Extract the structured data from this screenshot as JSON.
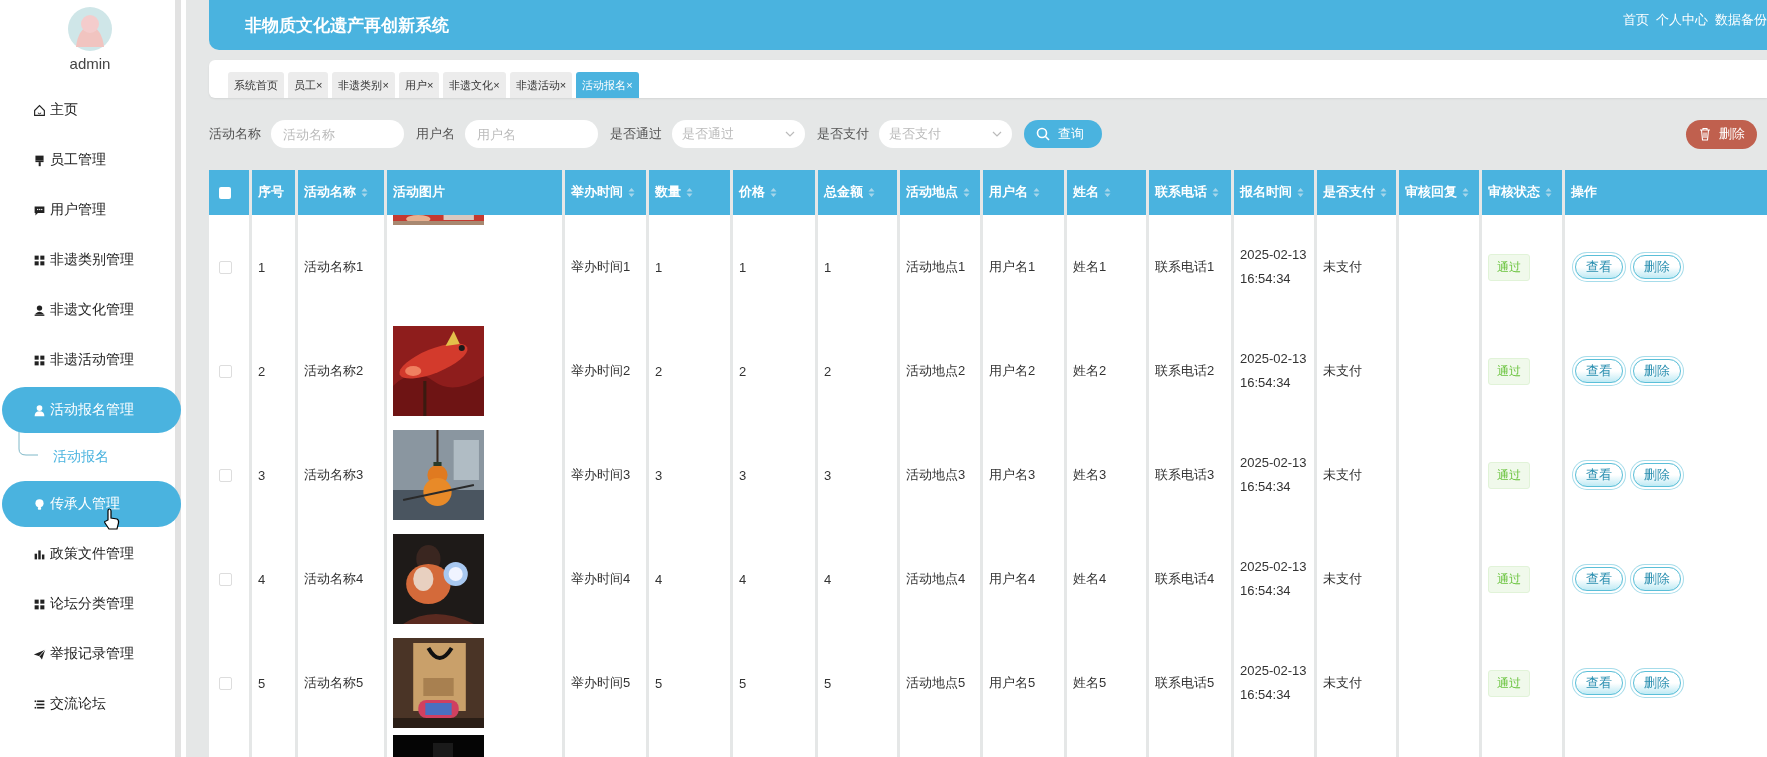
{
  "sidebar": {
    "user": {
      "name": "admin"
    },
    "items": [
      {
        "label": "主页",
        "highlighted": false
      },
      {
        "label": "员工管理",
        "highlighted": false
      },
      {
        "label": "用户管理",
        "highlighted": false
      },
      {
        "label": "非遗类别管理",
        "highlighted": false
      },
      {
        "label": "非遗文化管理",
        "highlighted": false
      },
      {
        "label": "非遗活动管理",
        "highlighted": false
      },
      {
        "label": "活动报名管理",
        "highlighted": true,
        "expanded": true,
        "children": [
          {
            "label": "活动报名",
            "selected": true
          }
        ]
      },
      {
        "label": "传承人管理",
        "highlighted": true
      },
      {
        "label": "政策文件管理",
        "highlighted": false
      },
      {
        "label": "论坛分类管理",
        "highlighted": false
      },
      {
        "label": "举报记录管理",
        "highlighted": false
      },
      {
        "label": "交流论坛",
        "highlighted": false
      }
    ]
  },
  "header": {
    "title": "非物质文化遗产再创新系统",
    "links": [
      "首页",
      "个人中心",
      "数据备份"
    ]
  },
  "tabs": [
    {
      "label": "系统首页",
      "selected": false
    },
    {
      "label": "员工",
      "close": "×",
      "selected": false
    },
    {
      "label": "非遗类别",
      "close": "×",
      "selected": false
    },
    {
      "label": "用户",
      "close": "×",
      "selected": false
    },
    {
      "label": "非遗文化",
      "close": "×",
      "selected": false
    },
    {
      "label": "非遗活动",
      "close": "×",
      "selected": false
    },
    {
      "label": "活动报名",
      "close": "×",
      "selected": true
    }
  ],
  "filters": [
    {
      "kind": "input",
      "label": "活动名称",
      "placeholder": "活动名称"
    },
    {
      "kind": "input",
      "label": "用户名",
      "placeholder": "用户名"
    },
    {
      "kind": "select",
      "label": "是否通过",
      "placeholder": "是否通过"
    },
    {
      "kind": "select",
      "label": "是否支付",
      "placeholder": "是否支付"
    }
  ],
  "search_button": "查询",
  "delete_button": "删除",
  "table": {
    "header_checked": false,
    "columns": [
      {
        "label": "序号",
        "sortable": false
      },
      {
        "label": "活动名称",
        "sortable": true
      },
      {
        "label": "活动图片",
        "sortable": false
      },
      {
        "label": "举办时间",
        "sortable": true
      },
      {
        "label": "数量",
        "sortable": true
      },
      {
        "label": "价格",
        "sortable": true
      },
      {
        "label": "总金额",
        "sortable": true
      },
      {
        "label": "活动地点",
        "sortable": true
      },
      {
        "label": "用户名",
        "sortable": true
      },
      {
        "label": "姓名",
        "sortable": true
      },
      {
        "label": "联系电话",
        "sortable": true
      },
      {
        "label": "报名时间",
        "sortable": true
      },
      {
        "label": "是否支付",
        "sortable": true
      },
      {
        "label": "审核回复",
        "sortable": true
      },
      {
        "label": "审核状态",
        "sortable": true
      },
      {
        "label": "操作",
        "sortable": false
      }
    ],
    "rows": [
      {
        "checked": false,
        "cells": [
          "1",
          "活动名称1",
          "",
          "举办时间1",
          "1",
          "1",
          "1",
          "活动地点1",
          "用户名1",
          "姓名1",
          "联系电话1",
          "2025-02-13 16:54:34",
          "未支付",
          "",
          "通过"
        ],
        "actions": [
          "查看",
          "删除"
        ]
      },
      {
        "checked": false,
        "cells": [
          "2",
          "活动名称2",
          "",
          "举办时间2",
          "2",
          "2",
          "2",
          "活动地点2",
          "用户名2",
          "姓名2",
          "联系电话2",
          "2025-02-13 16:54:34",
          "未支付",
          "",
          "通过"
        ],
        "actions": [
          "查看",
          "删除"
        ]
      },
      {
        "checked": false,
        "cells": [
          "3",
          "活动名称3",
          "",
          "举办时间3",
          "3",
          "3",
          "3",
          "活动地点3",
          "用户名3",
          "姓名3",
          "联系电话3",
          "2025-02-13 16:54:34",
          "未支付",
          "",
          "通过"
        ],
        "actions": [
          "查看",
          "删除"
        ]
      },
      {
        "checked": false,
        "cells": [
          "4",
          "活动名称4",
          "",
          "举办时间4",
          "4",
          "4",
          "4",
          "活动地点4",
          "用户名4",
          "姓名4",
          "联系电话4",
          "2025-02-13 16:54:34",
          "未支付",
          "",
          "通过"
        ],
        "actions": [
          "查看",
          "删除"
        ]
      },
      {
        "checked": false,
        "cells": [
          "5",
          "活动名称5",
          "",
          "举办时间5",
          "5",
          "5",
          "5",
          "活动地点5",
          "用户名5",
          "姓名5",
          "联系电话5",
          "2025-02-13 16:54:34",
          "未支付",
          "",
          "通过"
        ],
        "actions": [
          "查看",
          "删除"
        ]
      }
    ]
  }
}
